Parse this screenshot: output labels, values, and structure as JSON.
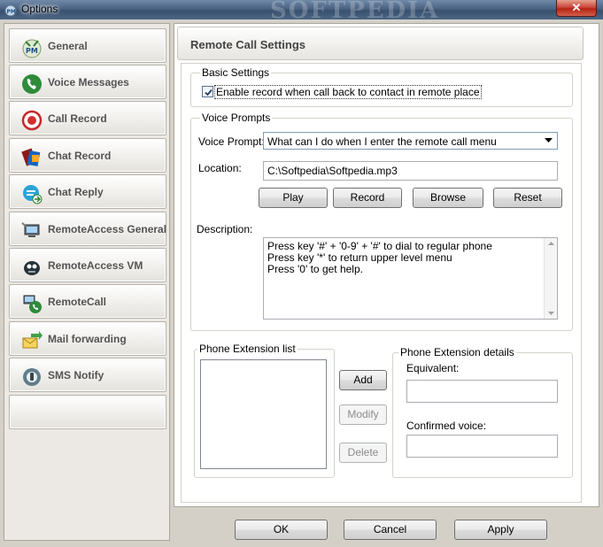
{
  "window": {
    "title": "Options",
    "watermark": "SOFTPEDIA",
    "close_glyph": "✕"
  },
  "sidebar": {
    "items": [
      {
        "label": "General",
        "icon": "pm-logo-icon"
      },
      {
        "label": "Voice Messages",
        "icon": "voice-messages-icon"
      },
      {
        "label": "Call Record",
        "icon": "record-icon"
      },
      {
        "label": "Chat Record",
        "icon": "chat-record-book-icon"
      },
      {
        "label": "Chat Reply",
        "icon": "chat-reply-icon"
      },
      {
        "label": "RemoteAccess General",
        "icon": "computer-phone-icon"
      },
      {
        "label": "RemoteAccess VM",
        "icon": "voicemail-robot-icon"
      },
      {
        "label": "RemoteCall",
        "icon": "remote-call-icon"
      },
      {
        "label": "Mail forwarding",
        "icon": "mail-forward-icon"
      },
      {
        "label": "SMS Notify",
        "icon": "sms-notify-icon"
      }
    ]
  },
  "main": {
    "page_title": "Remote Call Settings",
    "basic_settings": {
      "title": "Basic Settings",
      "enable_record_label": "Enable record when call back to contact in remote place",
      "enable_record_checked": true
    },
    "voice_prompts": {
      "title": "Voice Prompts",
      "voice_prompt_label": "Voice Prompt:",
      "voice_prompt_value": "What can I do when I enter the remote call menu",
      "location_label": "Location:",
      "location_value": "C:\\Softpedia\\Softpedia.mp3",
      "play_label": "Play",
      "record_label": "Record",
      "browse_label": "Browse",
      "reset_label": "Reset",
      "description_label": "Description:",
      "description_lines": [
        "Press key '#' + '0-9' + '#' to dial to regular phone",
        "Press key '*' to return upper level menu",
        "Press '0' to get help."
      ]
    },
    "extension_list": {
      "title": "Phone Extension list",
      "add_label": "Add",
      "modify_label": "Modify",
      "delete_label": "Delete"
    },
    "extension_details": {
      "title": "Phone Extension details",
      "equivalent_label": "Equivalent:",
      "equivalent_value": "",
      "confirmed_voice_label": "Confirmed voice:",
      "confirmed_voice_value": ""
    }
  },
  "footer": {
    "ok_label": "OK",
    "cancel_label": "Cancel",
    "apply_label": "Apply"
  }
}
